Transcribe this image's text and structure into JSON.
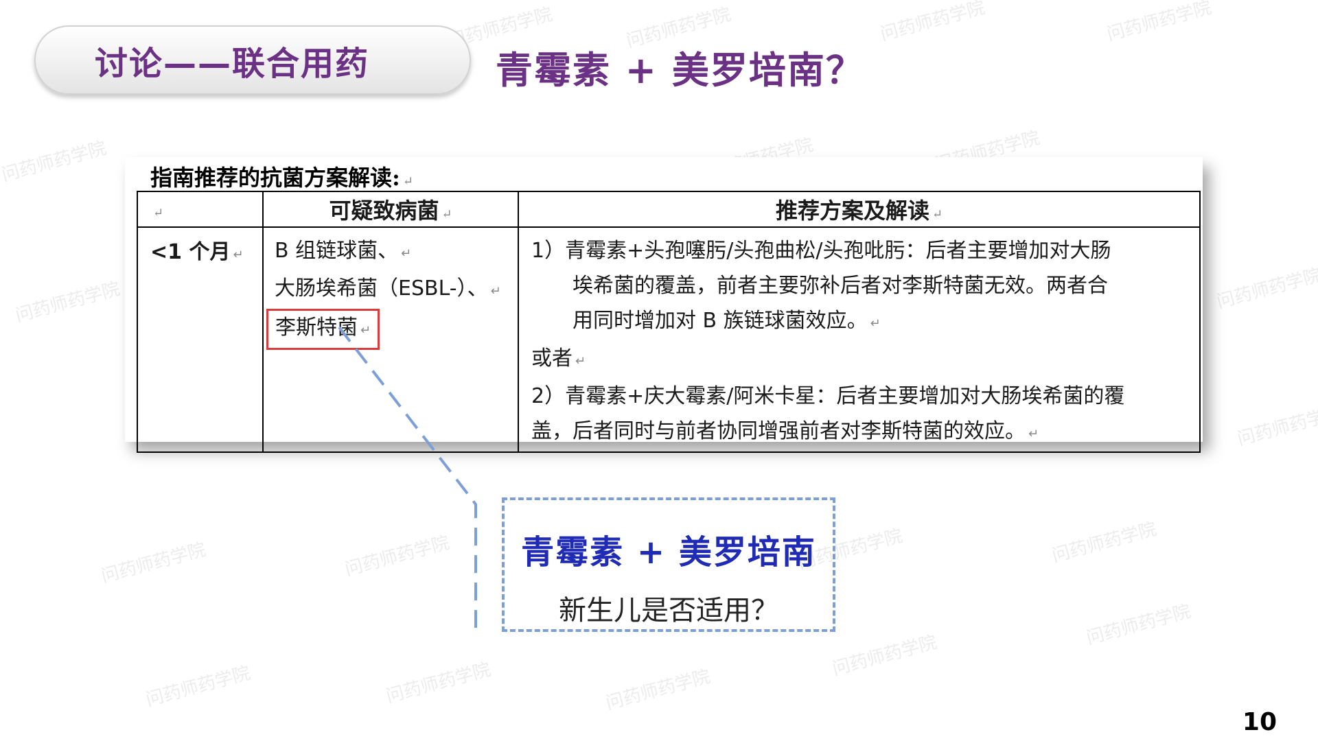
{
  "section_label": "讨论——联合用药",
  "heading": "青霉素 + 美罗培南？",
  "doc": {
    "caption": "指南推荐的抗菌方案解读:",
    "return_mark": "↵",
    "table": {
      "headers": [
        "",
        "可疑致病菌",
        "推荐方案及解读"
      ],
      "row": {
        "age": "<1 个月",
        "pathogens": [
          "B 组链球菌、",
          "大肠埃希菌（ESBL-）、",
          "李斯特菌"
        ],
        "recommendation_lines": [
          "1）青霉素+头孢噻肟/头孢曲松/头孢吡肟：后者主要增加对大肠",
          "埃希菌的覆盖，前者主要弥补后者对李斯特菌无效。两者合",
          "用同时增加对 B 族链球菌效应。",
          "或者",
          "2）青霉素+庆大霉素/阿米卡星：后者主要增加对大肠埃希菌的覆",
          "盖，后者同时与前者协同增强前者对李斯特菌的效应。"
        ]
      }
    }
  },
  "callout": {
    "title": "青霉素 + 美罗培南",
    "question": "新生儿是否适用？"
  },
  "page_number": "10",
  "watermark": "问药师药学院"
}
